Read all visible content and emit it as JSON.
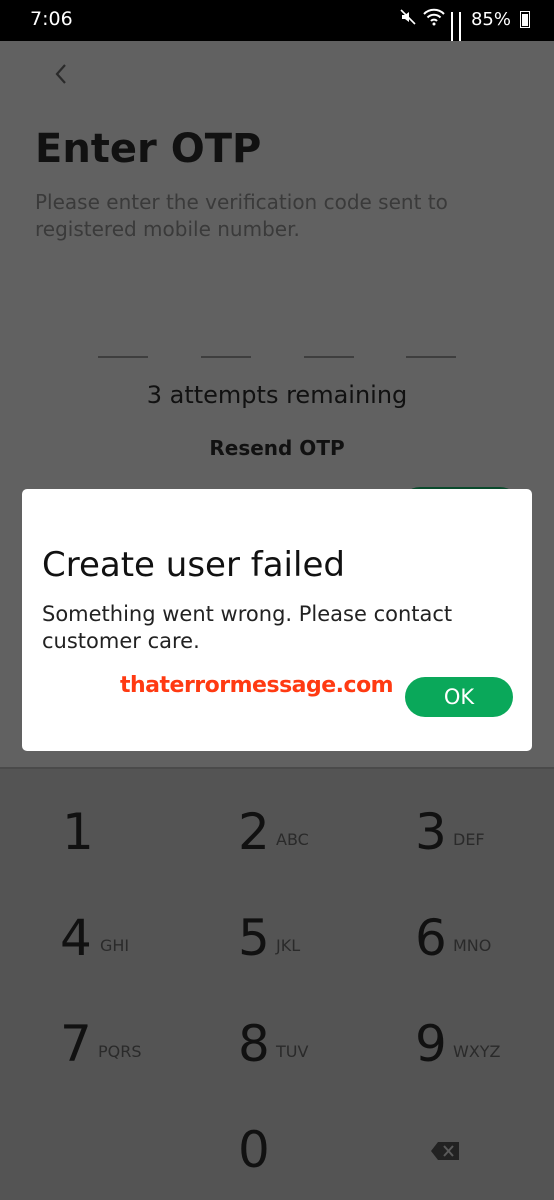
{
  "status_bar": {
    "time": "7:06",
    "battery": "85%",
    "icons": [
      "mute-icon",
      "wifi-icon",
      "signal-icon",
      "signal-icon"
    ]
  },
  "otp_screen": {
    "back_icon": "chevron-left-icon",
    "title": "Enter OTP",
    "subtitle": "Please enter the verification code sent to registered mobile number.",
    "slot_count": 4,
    "attempts": "3 attempts remaining",
    "resend": "Resend OTP"
  },
  "dialog": {
    "title": "Create user failed",
    "message": "Something went wrong. Please contact customer care.",
    "watermark": "thaterrormessage.com",
    "ok_label": "OK",
    "ok_color": "#0aa85a"
  },
  "keypad": {
    "keys": [
      {
        "digit": "1",
        "letters": ""
      },
      {
        "digit": "2",
        "letters": "ABC"
      },
      {
        "digit": "3",
        "letters": "DEF"
      },
      {
        "digit": "4",
        "letters": "GHI"
      },
      {
        "digit": "5",
        "letters": "JKL"
      },
      {
        "digit": "6",
        "letters": "MNO"
      },
      {
        "digit": "7",
        "letters": "PQRS"
      },
      {
        "digit": "8",
        "letters": "TUV"
      },
      {
        "digit": "9",
        "letters": "WXYZ"
      },
      {
        "digit": "0",
        "letters": ""
      }
    ],
    "backspace_icon": "backspace-icon"
  }
}
